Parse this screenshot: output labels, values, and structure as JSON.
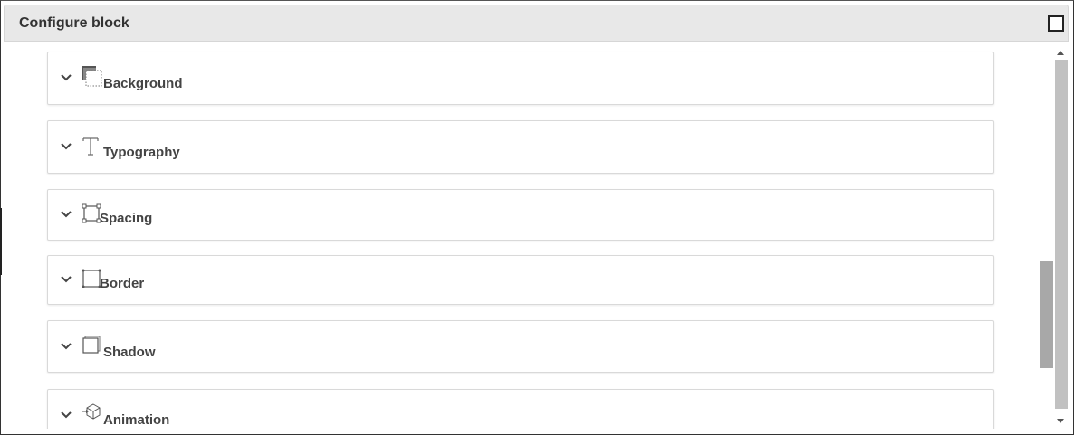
{
  "dialog": {
    "title": "Configure block",
    "maximize_icon": "square-outline-icon"
  },
  "sections": [
    {
      "label": "Background",
      "icon": "background-icon"
    },
    {
      "label": "Typography",
      "icon": "typography-icon"
    },
    {
      "label": "Spacing",
      "icon": "spacing-icon"
    },
    {
      "label": "Border",
      "icon": "border-icon"
    },
    {
      "label": "Shadow",
      "icon": "shadow-icon"
    },
    {
      "label": "Animation",
      "icon": "animation-icon"
    }
  ],
  "colors": {
    "titlebar": "#e8e8e8",
    "text": "#444444",
    "scrollbar_thumb": "#c1c1c1"
  }
}
